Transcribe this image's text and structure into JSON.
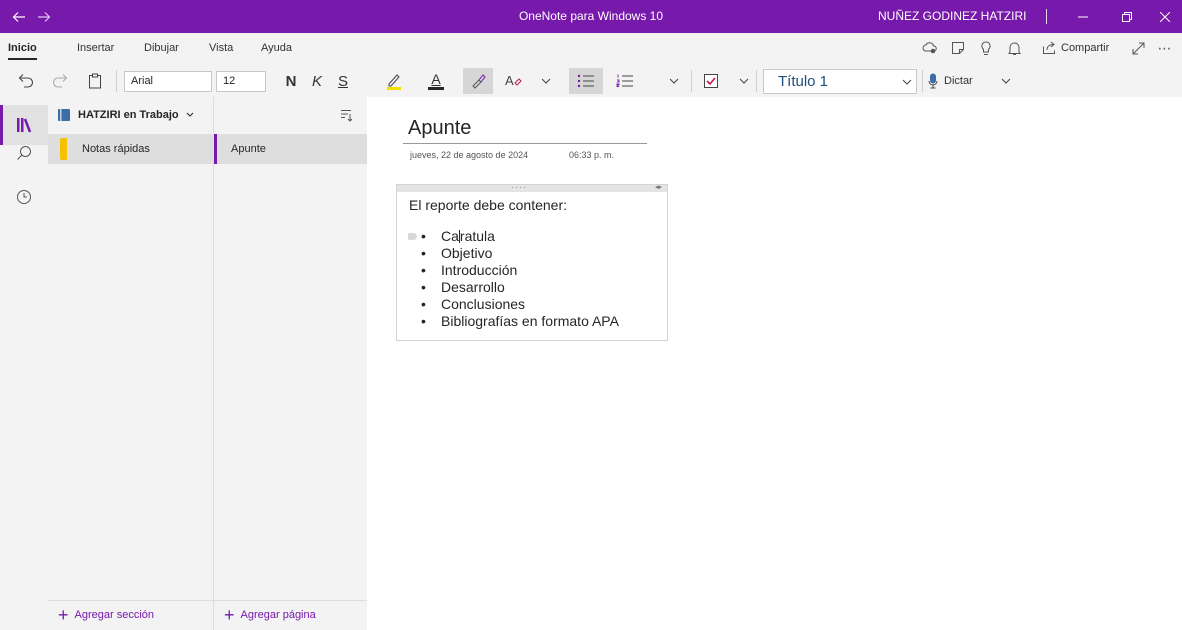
{
  "window": {
    "title": "OneNote para Windows 10",
    "user": "NUÑEZ GODINEZ HATZIRI",
    "accent": "#7719aa"
  },
  "menu": {
    "tabs": [
      {
        "label": "Inicio",
        "active": true
      },
      {
        "label": "Insertar",
        "active": false
      },
      {
        "label": "Dibujar",
        "active": false
      },
      {
        "label": "Vista",
        "active": false
      },
      {
        "label": "Ayuda",
        "active": false
      }
    ],
    "share_label": "Compartir"
  },
  "ribbon": {
    "font_family": "Arial",
    "font_size": "12",
    "bold_label": "N",
    "italic_label": "K",
    "underline_label": "S",
    "font_color_label": "A",
    "style_label": "Título 1",
    "dictate_label": "Dictar",
    "highlight_color": "#f4e100",
    "checkbox_color": "#c2185b"
  },
  "notebook": {
    "name": "HATZIRI en Trabajo"
  },
  "sections": {
    "items": [
      {
        "label": "Notas rápidas",
        "color": "#f4c100"
      }
    ],
    "add_label": "Agregar sección"
  },
  "pages": {
    "items": [
      {
        "label": "Apunte"
      }
    ],
    "add_label": "Agregar página"
  },
  "page": {
    "title": "Apunte",
    "date": "jueves, 22 de agosto de 2024",
    "time": "06:33 p. m.",
    "intro": "El reporte debe contener:",
    "first_item_before_caret": "Ca",
    "first_item_after_caret": "ratula",
    "items": [
      "Objetivo",
      "Introducción",
      "Desarrollo",
      "Conclusiones",
      "Bibliografías en formato APA"
    ]
  }
}
